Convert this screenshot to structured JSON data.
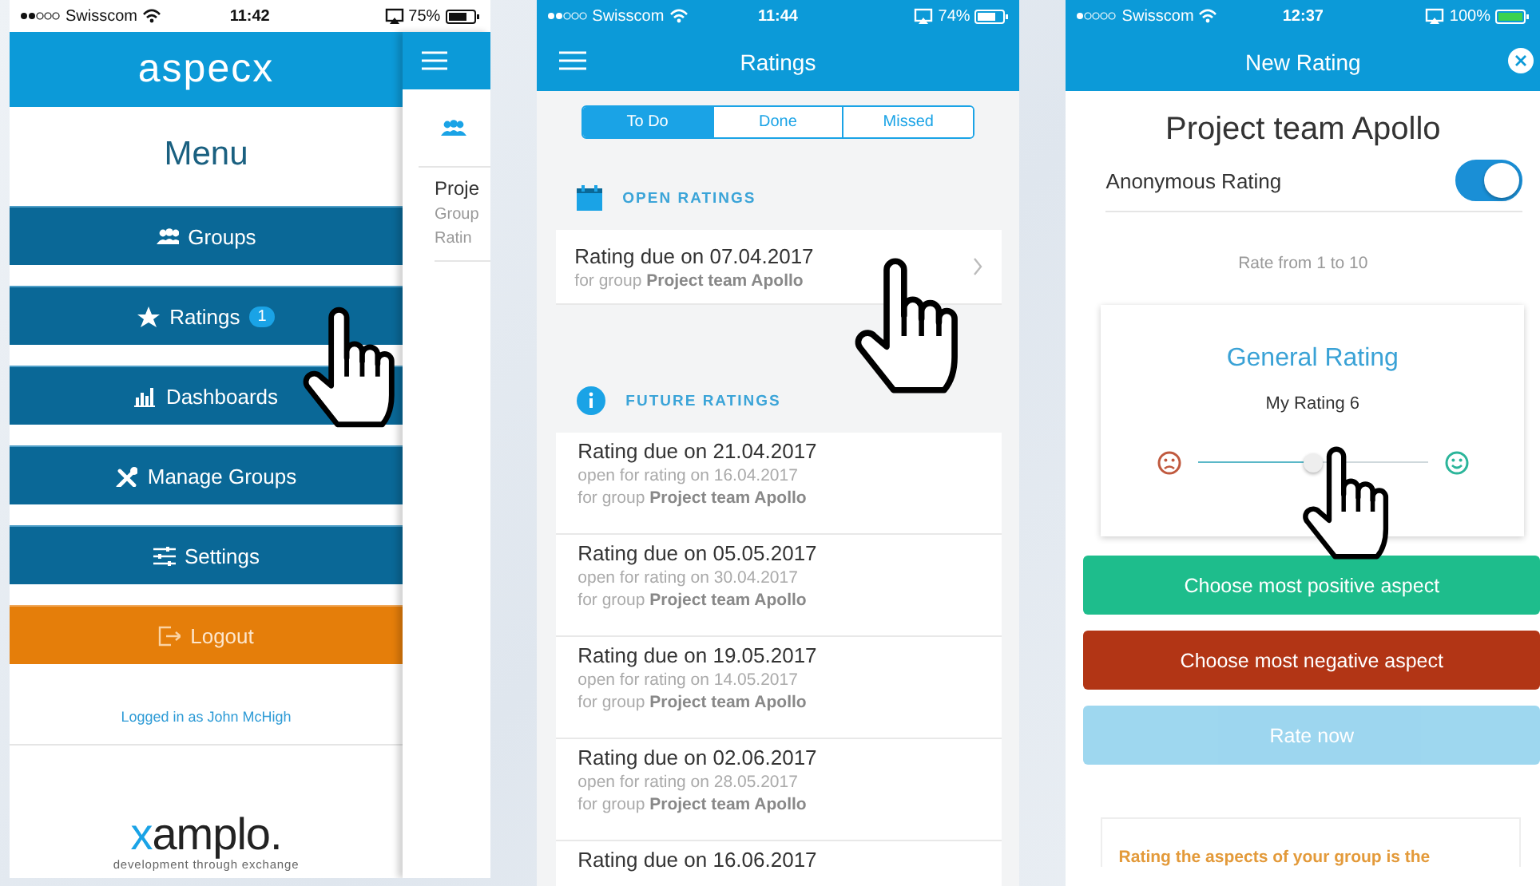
{
  "screens": [
    {
      "kind": "menu",
      "status_bar": {
        "carrier": "Swisscom",
        "time": "11:42",
        "battery": "75%"
      },
      "logo": "aspecx",
      "title": "Menu",
      "items": [
        {
          "kind": "nav",
          "label": "Groups"
        },
        {
          "kind": "nav",
          "label": "Ratings",
          "badge": "1"
        },
        {
          "kind": "nav",
          "label": "Dashboards"
        },
        {
          "kind": "nav",
          "label": "Manage Groups"
        },
        {
          "kind": "nav",
          "label": "Settings"
        },
        {
          "kind": "logout",
          "label": "Logout"
        }
      ],
      "logged_in": "Logged in as John McHigh",
      "footer_logo": {
        "mark": "x",
        "rest": "amplo."
      },
      "footer_tagline": "development through exchange",
      "behind": {
        "title": "Proje",
        "lines": [
          "Group",
          "Ratin"
        ]
      }
    },
    {
      "kind": "list",
      "status_bar": {
        "carrier": "Swisscom",
        "time": "11:44",
        "battery": "74%"
      },
      "title": "Ratings",
      "tabs": [
        {
          "label": "To Do",
          "selected": true
        },
        {
          "label": "Done",
          "selected": false
        },
        {
          "label": "Missed",
          "selected": false
        }
      ],
      "open_heading": "OPEN RATINGS",
      "open_ratings": [
        {
          "title": "Rating due on 07.04.2017",
          "group": "for group **Project team Apollo**"
        }
      ],
      "future_heading": "FUTURE RATINGS",
      "future_ratings": [
        {
          "title": "Rating due on 21.04.2017",
          "opens": "open for rating on 16.04.2017",
          "group": "for group **Project team Apollo**"
        },
        {
          "title": "Rating due on 05.05.2017",
          "opens": "open for rating on 30.04.2017",
          "group": "for group **Project team Apollo**"
        },
        {
          "title": "Rating due on 19.05.2017",
          "opens": "open for rating on 14.05.2017",
          "group": "for group **Project team Apollo**"
        },
        {
          "title": "Rating due on 02.06.2017",
          "opens": "open for rating on 28.05.2017",
          "group": "for group **Project team Apollo**"
        },
        {
          "title": "Rating due on 16.06.2017"
        }
      ]
    },
    {
      "kind": "form",
      "status_bar": {
        "carrier": "Swisscom",
        "time": "12:37",
        "battery": "100%"
      },
      "title": "New Rating",
      "group": "Project team Apollo",
      "anonymous": {
        "label": "Anonymous Rating",
        "on": true
      },
      "scale_hint": "Rate from 1 to 10",
      "card_title": "General Rating",
      "reading": "My Rating 6",
      "slider": {
        "level": 0.5
      },
      "buttons": [
        {
          "kind": "positive",
          "label": "Choose most positive aspect",
          "disabled": false
        },
        {
          "kind": "negative",
          "label": "Choose most negative aspect",
          "disabled": false
        },
        {
          "kind": "submit",
          "label": "Rate now",
          "disabled": true
        }
      ],
      "note": "Rating the aspects of your group is the"
    }
  ]
}
